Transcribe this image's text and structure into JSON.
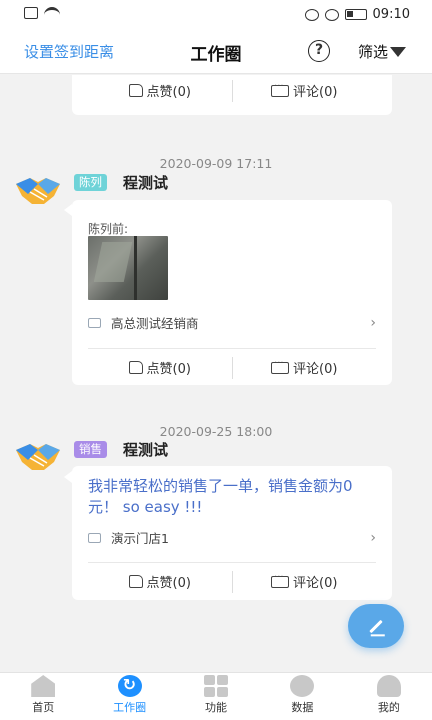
{
  "status_bar": {
    "time": "09:10"
  },
  "header": {
    "left_link": "设置签到距离",
    "title": "工作圈",
    "help": "?",
    "filter": "筛选"
  },
  "posts": [
    {
      "likes": "点赞(0)",
      "comments": "评论(0)"
    },
    {
      "timestamp": "2020-09-09 17:11",
      "tag": "陈列",
      "author": "程测试",
      "label": "陈列前:",
      "store": "高总测试经销商",
      "likes": "点赞(0)",
      "comments": "评论(0)"
    },
    {
      "timestamp": "2020-09-25 18:00",
      "tag": "销售",
      "author": "程测试",
      "text": "我非常轻松的销售了一单，销售金额为0元！ so easy !!!",
      "store": "演示门店1",
      "likes": "点赞(0)",
      "comments": "评论(0)"
    }
  ],
  "tabbar": {
    "tabs": [
      {
        "label": "首页"
      },
      {
        "label": "工作圈"
      },
      {
        "label": "功能"
      },
      {
        "label": "数据"
      },
      {
        "label": "我的"
      }
    ]
  },
  "colors": {
    "accent": "#1e90ff",
    "link": "#3a8ee6",
    "sale_text": "#4a6fc9",
    "tag_display": "#6fd3d8",
    "tag_sale": "#a98ce8"
  }
}
